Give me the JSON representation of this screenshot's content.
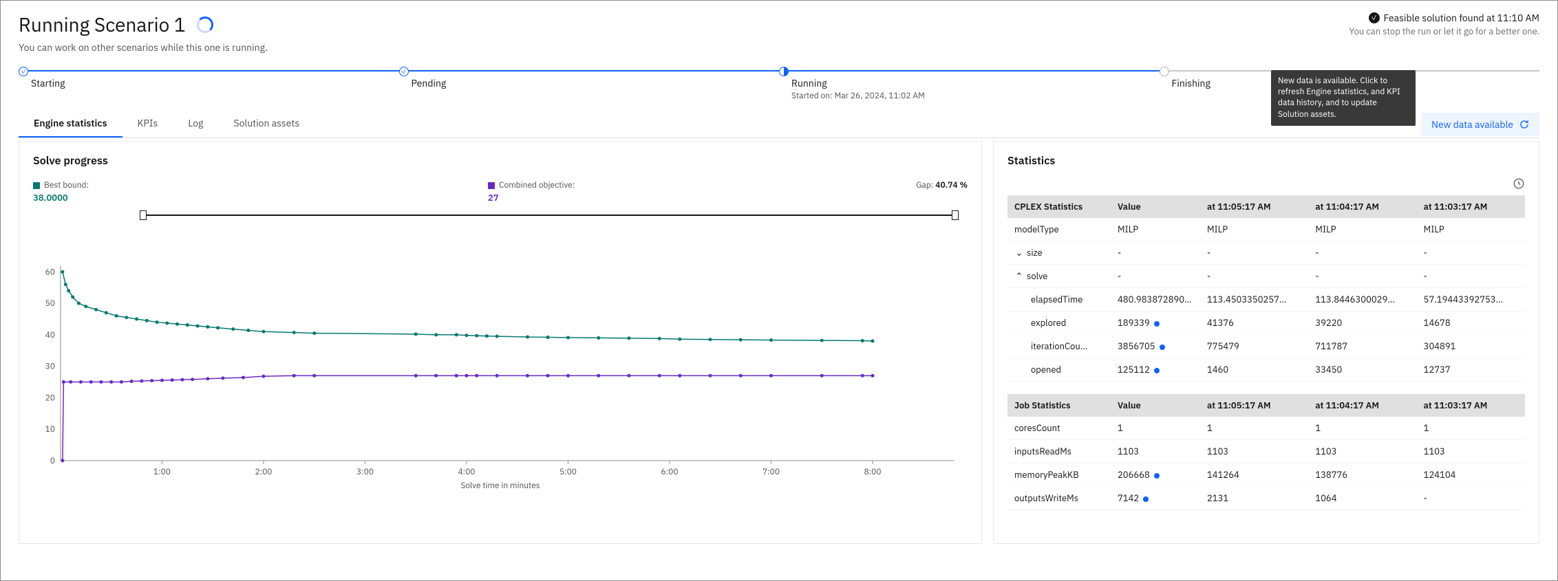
{
  "header": {
    "title": "Running Scenario 1",
    "subtitle": "You can work on other scenarios while this one is running.",
    "status_line": "Feasible solution found at 11:10 AM",
    "status_sub": "You can stop the run or let it go for a better one."
  },
  "stepper": {
    "steps": [
      {
        "label": "Starting",
        "state": "done"
      },
      {
        "label": "Pending",
        "state": "done"
      },
      {
        "label": "Running",
        "state": "active",
        "sub": "Started on: Mar 26, 2024, 11:02 AM"
      },
      {
        "label": "Finishing",
        "state": "future"
      }
    ]
  },
  "tabs": {
    "items": [
      "Engine statistics",
      "KPIs",
      "Log",
      "Solution assets"
    ],
    "active": 0,
    "refresh_label": "New data available",
    "tooltip": "New data is available. Click to refresh Engine statistics, and KPI data history, and to update Solution assets."
  },
  "solve_progress": {
    "title": "Solve progress",
    "legend": {
      "best_bound_label": "Best bound:",
      "best_bound_value": "38.0000",
      "combined_label": "Combined objective:",
      "combined_value": "27",
      "gap_label": "Gap:",
      "gap_value": "40.74 %"
    },
    "xlabel": "Solve time in minutes"
  },
  "chart_data": {
    "type": "line",
    "xlabel": "Solve time in minutes",
    "ylim": [
      0,
      62
    ],
    "xlim_minutes": [
      0,
      8.8
    ],
    "x_ticks": [
      "1:00",
      "2:00",
      "3:00",
      "4:00",
      "5:00",
      "6:00",
      "7:00",
      "8:00"
    ],
    "y_ticks": [
      0,
      10,
      20,
      30,
      40,
      50,
      60
    ],
    "series": [
      {
        "name": "Best bound",
        "color": "#047970",
        "points": [
          {
            "x": 0.02,
            "y": 60
          },
          {
            "x": 0.05,
            "y": 56
          },
          {
            "x": 0.08,
            "y": 54
          },
          {
            "x": 0.12,
            "y": 52
          },
          {
            "x": 0.18,
            "y": 50
          },
          {
            "x": 0.25,
            "y": 49
          },
          {
            "x": 0.35,
            "y": 48
          },
          {
            "x": 0.45,
            "y": 47
          },
          {
            "x": 0.55,
            "y": 46
          },
          {
            "x": 0.65,
            "y": 45.5
          },
          {
            "x": 0.75,
            "y": 45
          },
          {
            "x": 0.85,
            "y": 44.5
          },
          {
            "x": 0.95,
            "y": 44
          },
          {
            "x": 1.05,
            "y": 43.7
          },
          {
            "x": 1.15,
            "y": 43.4
          },
          {
            "x": 1.25,
            "y": 43.1
          },
          {
            "x": 1.35,
            "y": 42.8
          },
          {
            "x": 1.45,
            "y": 42.5
          },
          {
            "x": 1.55,
            "y": 42.2
          },
          {
            "x": 1.7,
            "y": 41.8
          },
          {
            "x": 1.85,
            "y": 41.4
          },
          {
            "x": 2.0,
            "y": 41
          },
          {
            "x": 2.3,
            "y": 40.7
          },
          {
            "x": 2.5,
            "y": 40.5
          },
          {
            "x": 3.5,
            "y": 40.2
          },
          {
            "x": 3.7,
            "y": 40
          },
          {
            "x": 3.9,
            "y": 40
          },
          {
            "x": 4.0,
            "y": 39.8
          },
          {
            "x": 4.1,
            "y": 39.7
          },
          {
            "x": 4.2,
            "y": 39.6
          },
          {
            "x": 4.3,
            "y": 39.5
          },
          {
            "x": 4.6,
            "y": 39.3
          },
          {
            "x": 4.8,
            "y": 39.2
          },
          {
            "x": 5.0,
            "y": 39.1
          },
          {
            "x": 5.3,
            "y": 39
          },
          {
            "x": 5.6,
            "y": 38.9
          },
          {
            "x": 5.9,
            "y": 38.8
          },
          {
            "x": 6.1,
            "y": 38.6
          },
          {
            "x": 6.4,
            "y": 38.5
          },
          {
            "x": 6.7,
            "y": 38.4
          },
          {
            "x": 7.0,
            "y": 38.3
          },
          {
            "x": 7.5,
            "y": 38.2
          },
          {
            "x": 7.9,
            "y": 38.1
          },
          {
            "x": 8.0,
            "y": 38
          }
        ]
      },
      {
        "name": "Combined objective",
        "color": "#6929c4",
        "points": [
          {
            "x": 0.02,
            "y": 0
          },
          {
            "x": 0.03,
            "y": 25
          },
          {
            "x": 0.1,
            "y": 25
          },
          {
            "x": 0.2,
            "y": 25
          },
          {
            "x": 0.3,
            "y": 25
          },
          {
            "x": 0.4,
            "y": 25
          },
          {
            "x": 0.5,
            "y": 25
          },
          {
            "x": 0.6,
            "y": 25
          },
          {
            "x": 0.7,
            "y": 25.2
          },
          {
            "x": 0.8,
            "y": 25.3
          },
          {
            "x": 0.9,
            "y": 25.4
          },
          {
            "x": 1.0,
            "y": 25.5
          },
          {
            "x": 1.1,
            "y": 25.6
          },
          {
            "x": 1.2,
            "y": 25.7
          },
          {
            "x": 1.3,
            "y": 25.8
          },
          {
            "x": 1.45,
            "y": 26
          },
          {
            "x": 1.6,
            "y": 26.2
          },
          {
            "x": 1.8,
            "y": 26.4
          },
          {
            "x": 2.0,
            "y": 26.8
          },
          {
            "x": 2.3,
            "y": 27
          },
          {
            "x": 2.5,
            "y": 27
          },
          {
            "x": 3.5,
            "y": 27
          },
          {
            "x": 3.7,
            "y": 27
          },
          {
            "x": 3.9,
            "y": 27
          },
          {
            "x": 4.0,
            "y": 27
          },
          {
            "x": 4.1,
            "y": 27
          },
          {
            "x": 4.3,
            "y": 27
          },
          {
            "x": 4.6,
            "y": 27
          },
          {
            "x": 4.8,
            "y": 27
          },
          {
            "x": 5.0,
            "y": 27
          },
          {
            "x": 5.3,
            "y": 27
          },
          {
            "x": 5.6,
            "y": 27
          },
          {
            "x": 5.9,
            "y": 27
          },
          {
            "x": 6.1,
            "y": 27
          },
          {
            "x": 6.4,
            "y": 27
          },
          {
            "x": 6.7,
            "y": 27
          },
          {
            "x": 7.0,
            "y": 27
          },
          {
            "x": 7.5,
            "y": 27
          },
          {
            "x": 7.9,
            "y": 27
          },
          {
            "x": 8.0,
            "y": 27
          }
        ]
      }
    ]
  },
  "statistics": {
    "title": "Statistics",
    "time_columns": [
      "at 11:05:17 AM",
      "at 11:04:17 AM",
      "at 11:03:17 AM"
    ],
    "cplex": {
      "header": "CPLEX Statistics",
      "value_header": "Value",
      "rows": [
        {
          "name": "modelType",
          "value": "MILP",
          "cols": [
            "MILP",
            "MILP",
            "MILP"
          ]
        },
        {
          "name": "size",
          "expand": "down",
          "value": "-",
          "cols": [
            "-",
            "-",
            "-"
          ]
        },
        {
          "name": "solve",
          "expand": "up",
          "value": "-",
          "cols": [
            "-",
            "-",
            "-"
          ]
        },
        {
          "name": "elapsedTime",
          "indent": true,
          "value": "480.983872890472",
          "truncated": true,
          "cols": [
            "113.4503350257...",
            "113.8446300029...",
            "57.19443392753..."
          ]
        },
        {
          "name": "explored",
          "indent": true,
          "value": "189339",
          "spark": true,
          "cols": [
            "41376",
            "39220",
            "14678"
          ]
        },
        {
          "name": "iterationCou...",
          "indent": true,
          "value": "3856705",
          "spark": true,
          "cols": [
            "775479",
            "711787",
            "304891"
          ]
        },
        {
          "name": "opened",
          "indent": true,
          "value": "125112",
          "spark": true,
          "cols": [
            "1460",
            "33450",
            "12737"
          ]
        }
      ]
    },
    "job": {
      "header": "Job Statistics",
      "value_header": "Value",
      "rows": [
        {
          "name": "coresCount",
          "value": "1",
          "cols": [
            "1",
            "1",
            "1"
          ]
        },
        {
          "name": "inputsReadMs",
          "value": "1103",
          "cols": [
            "1103",
            "1103",
            "1103"
          ]
        },
        {
          "name": "memoryPeakKB",
          "value": "206668",
          "spark": true,
          "cols": [
            "141264",
            "138776",
            "124104"
          ]
        },
        {
          "name": "outputsWriteMs",
          "value": "7142",
          "spark": true,
          "cols": [
            "2131",
            "1064",
            "-"
          ]
        }
      ]
    }
  }
}
